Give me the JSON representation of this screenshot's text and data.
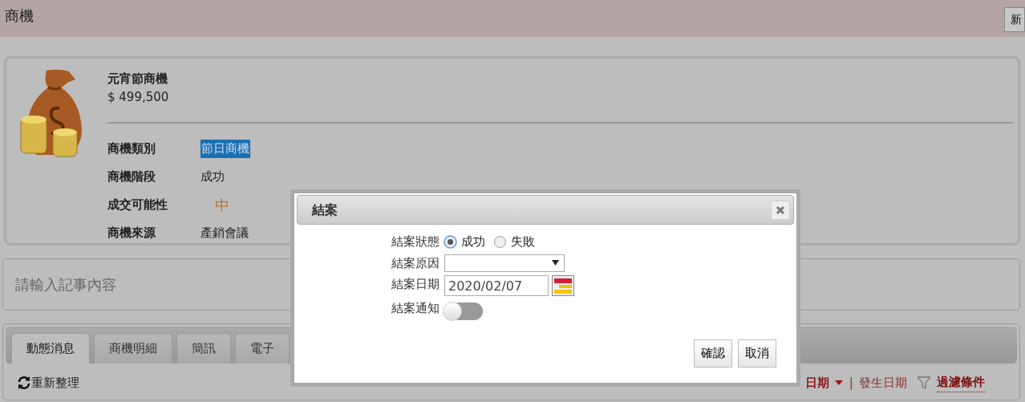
{
  "header": {
    "title": "商機",
    "new_button": "新"
  },
  "opportunity": {
    "name": "元宵節商機",
    "amount": "$ 499,500",
    "fields": [
      {
        "label": "商機類別",
        "value": "節日商機",
        "kind": "highlight"
      },
      {
        "label": "商機階段",
        "value": "成功",
        "kind": "plain"
      },
      {
        "label": "成交可能性",
        "value": "中",
        "kind": "level"
      },
      {
        "label": "商機來源",
        "value": "產銷會議",
        "kind": "plain"
      }
    ]
  },
  "note": {
    "placeholder": "請輸入記事內容"
  },
  "tabs": [
    {
      "label": "動態消息",
      "selected": true
    },
    {
      "label": "商機明細",
      "selected": false
    },
    {
      "label": "簡訊",
      "selected": false
    },
    {
      "label": "電子",
      "selected": false
    }
  ],
  "toolbar": {
    "refresh": "重新整理",
    "sort_label": "日期",
    "separator": "|",
    "other_sort": "發生日期",
    "filter": "過濾條件"
  },
  "dialog": {
    "title": "結案",
    "status_label": "結案狀態",
    "options": [
      {
        "label": "成功",
        "selected": true
      },
      {
        "label": "失敗",
        "selected": false
      }
    ],
    "reason_label": "結案原因",
    "date_label": "結案日期",
    "date": "2020/02/07",
    "notify_label": "結案通知",
    "notify_on": false,
    "buttons": [
      "確認",
      "取消"
    ]
  }
}
